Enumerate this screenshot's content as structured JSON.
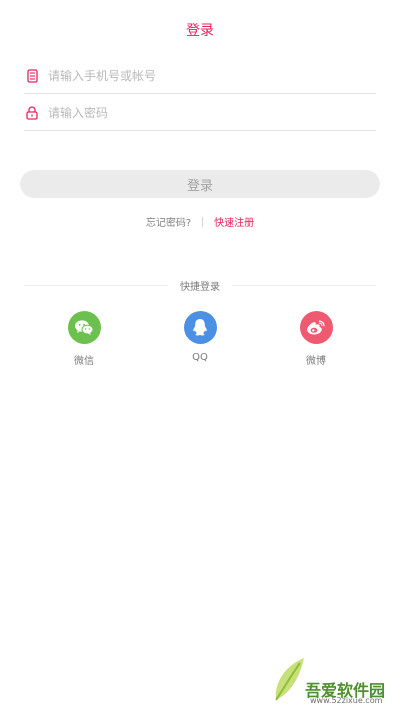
{
  "header": {
    "title": "登录"
  },
  "form": {
    "account": {
      "placeholder": "请输入手机号或帐号",
      "value": "",
      "icon": "phone-icon"
    },
    "password": {
      "placeholder": "请输入密码",
      "value": "",
      "icon": "lock-icon"
    },
    "login_button": "登录"
  },
  "links": {
    "forgot": "忘记密码?",
    "register": "快速注册"
  },
  "quick_login": {
    "title": "快捷登录",
    "items": [
      {
        "label": "微信",
        "icon": "wechat-icon",
        "color": "#6cc14e"
      },
      {
        "label": "QQ",
        "icon": "qq-icon",
        "color": "#4b90e2"
      },
      {
        "label": "微博",
        "icon": "weibo-icon",
        "color": "#ef5a71"
      }
    ]
  },
  "colors": {
    "accent": "#e4245a",
    "button_bg": "#ebebeb"
  },
  "watermark": {
    "text": "吾爱软件园",
    "url": "www.52zixue.com"
  }
}
